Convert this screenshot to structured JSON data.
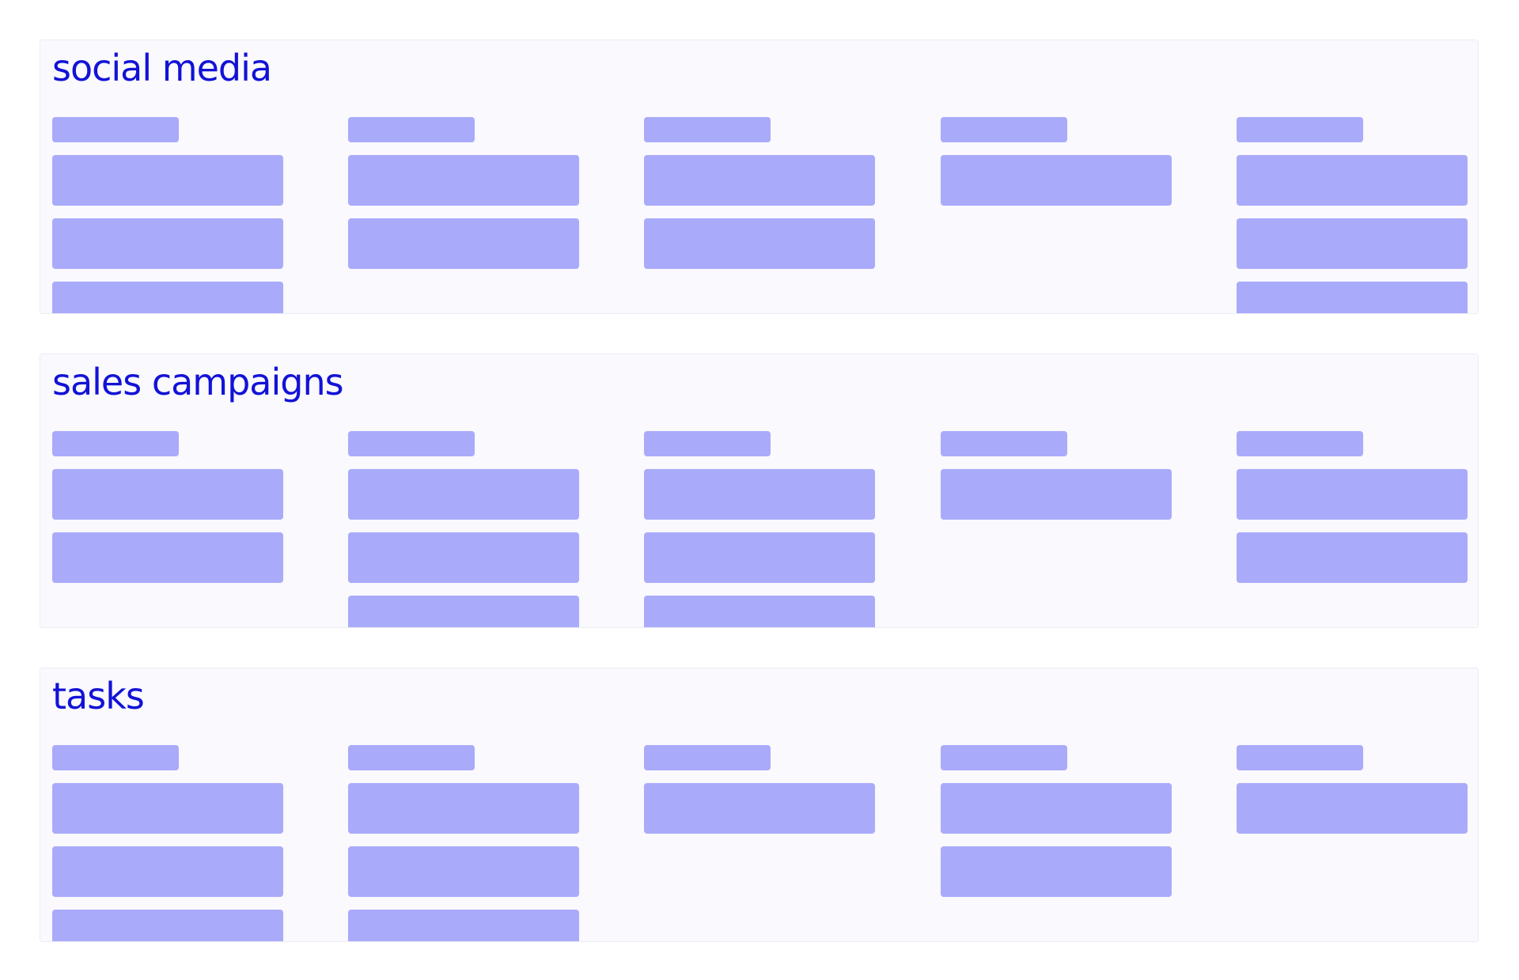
{
  "colors": {
    "title": "#1212d6",
    "placeholder": "#aaaafb",
    "board_background": "#f9f9fe",
    "board_border": "#ececf4"
  },
  "boards": [
    {
      "title": "social media",
      "columns": [
        {
          "cards": 3
        },
        {
          "cards": 2
        },
        {
          "cards": 2
        },
        {
          "cards": 1
        },
        {
          "cards": 3
        }
      ]
    },
    {
      "title": "sales campaigns",
      "columns": [
        {
          "cards": 2
        },
        {
          "cards": 3
        },
        {
          "cards": 3
        },
        {
          "cards": 1
        },
        {
          "cards": 2
        }
      ]
    },
    {
      "title": "tasks",
      "columns": [
        {
          "cards": 3
        },
        {
          "cards": 3
        },
        {
          "cards": 1
        },
        {
          "cards": 2
        },
        {
          "cards": 1
        }
      ]
    }
  ]
}
